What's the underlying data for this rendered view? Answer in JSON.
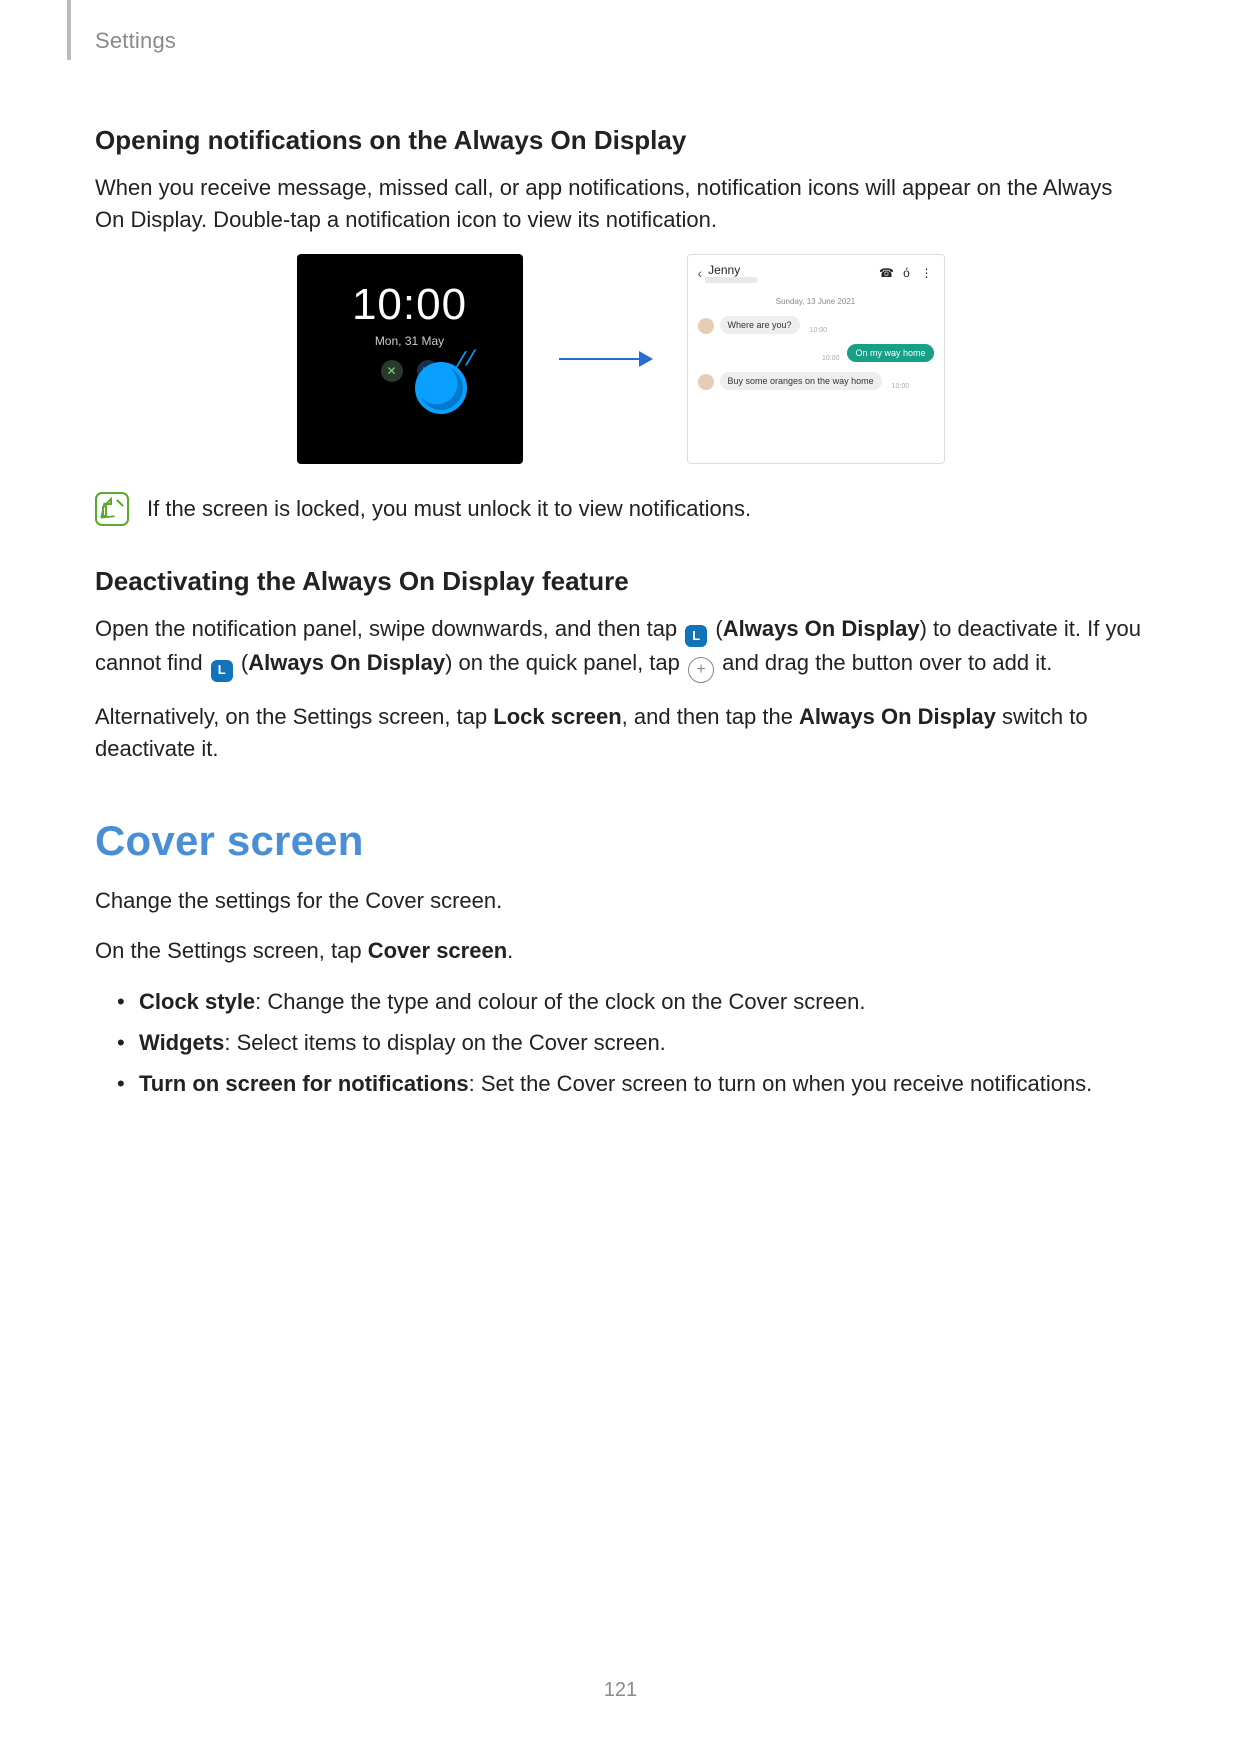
{
  "header": {
    "section_label": "Settings"
  },
  "s1": {
    "heading": "Opening notifications on the Always On Display",
    "body": "When you receive message, missed call, or app notifications, notification icons will appear on the Always On Display. Double-tap a notification icon to view its notification."
  },
  "aod": {
    "time": "10:00",
    "date": "Mon, 31 May"
  },
  "chat": {
    "name": "Jenny",
    "date": "Sunday, 13 June 2021",
    "msg1": "Where are you?",
    "t1": "10:00",
    "msg2": "On my way home",
    "t2": "10:00",
    "msg3": "Buy some oranges on the way home",
    "t3": "10:00"
  },
  "note": {
    "text": "If the screen is locked, you must unlock it to view notifications."
  },
  "s2": {
    "heading": "Deactivating the Always On Display feature",
    "p1a": "Open the notification panel, swipe downwards, and then tap ",
    "p1b": " (",
    "p1c": "Always On Display",
    "p1d": ") to deactivate it. If you cannot find ",
    "p1e": " (",
    "p1f": "Always On Display",
    "p1g": ") on the quick panel, tap ",
    "p1h": " and drag the button over to add it.",
    "p2a": "Alternatively, on the Settings screen, tap ",
    "p2b": "Lock screen",
    "p2c": ", and then tap the ",
    "p2d": "Always On Display",
    "p2e": " switch to deactivate it."
  },
  "cover": {
    "title": "Cover screen",
    "intro": "Change the settings for the Cover screen.",
    "nav_a": "On the Settings screen, tap ",
    "nav_b": "Cover screen",
    "nav_c": ".",
    "items": [
      {
        "label": "Clock style",
        "desc": ": Change the type and colour of the clock on the Cover screen."
      },
      {
        "label": "Widgets",
        "desc": ": Select items to display on the Cover screen."
      },
      {
        "label": "Turn on screen for notifications",
        "desc": ": Set the Cover screen to turn on when you receive notifications."
      }
    ]
  },
  "icons": {
    "aod_clock_glyph": "L",
    "plus_glyph": "+"
  },
  "page_number": "121"
}
